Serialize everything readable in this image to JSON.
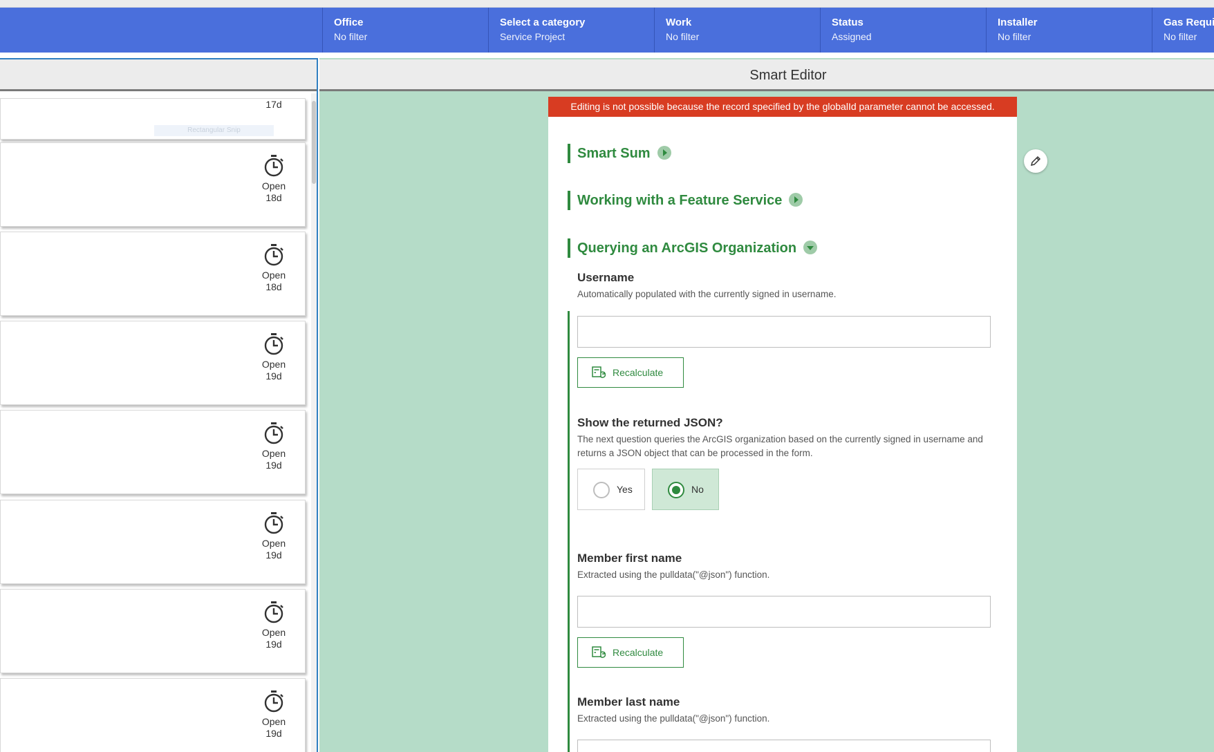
{
  "filters": [
    {
      "label": "Office",
      "value": "No filter"
    },
    {
      "label": "Select a category",
      "value": "Service Project"
    },
    {
      "label": "Work",
      "value": "No filter"
    },
    {
      "label": "Status",
      "value": "Assigned"
    },
    {
      "label": "Installer",
      "value": "No filter"
    },
    {
      "label": "Gas Requir",
      "value": "No filter"
    }
  ],
  "list": {
    "first_card_status": "17d",
    "snip_overlay": "Rectangular Snip",
    "cards": [
      {
        "status": "Open",
        "age": "18d"
      },
      {
        "status": "Open",
        "age": "18d"
      },
      {
        "status": "Open",
        "age": "19d"
      },
      {
        "status": "Open",
        "age": "19d"
      },
      {
        "status": "Open",
        "age": "19d"
      },
      {
        "status": "Open",
        "age": "19d"
      },
      {
        "status": "Open",
        "age": "19d"
      }
    ]
  },
  "editor": {
    "title": "Smart Editor",
    "error": "Editing is not possible because the record specified by the globalId parameter cannot be accessed.",
    "groups": [
      {
        "title": "Smart Sum",
        "expanded": false
      },
      {
        "title": "Working with a Feature Service",
        "expanded": false
      },
      {
        "title": "Querying an ArcGIS Organization",
        "expanded": true
      }
    ],
    "questions": {
      "username": {
        "label": "Username",
        "hint": "Automatically populated with the currently signed in username.",
        "value": ""
      },
      "recalculate_label": "Recalculate",
      "show_json": {
        "label": "Show the returned JSON?",
        "hint": "The next question queries the ArcGIS organization based on the currently signed in username and returns a JSON object that can be processed in the form.",
        "options": [
          "Yes",
          "No"
        ],
        "selected": "No"
      },
      "first_name": {
        "label": "Member first name",
        "hint": "Extracted using the pulldata(\"@json\") function.",
        "value": ""
      },
      "last_name": {
        "label": "Member last name",
        "hint": "Extracted using the pulldata(\"@json\") function."
      }
    }
  },
  "colors": {
    "filter_bar": "#4a6fdc",
    "accent_green": "#2f8a3f",
    "error_red": "#d83c22",
    "canvas_green": "#b5dcc8"
  }
}
